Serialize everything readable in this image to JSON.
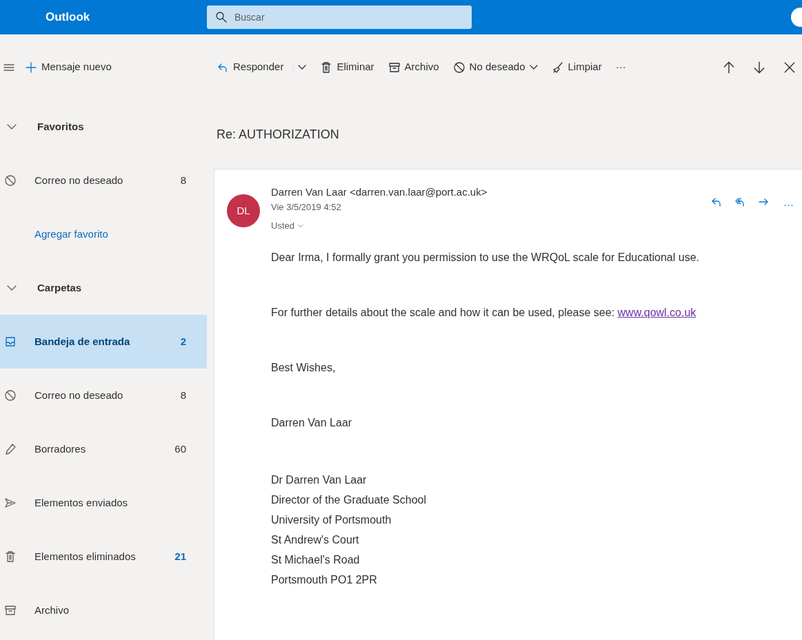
{
  "header": {
    "app_name": "Outlook",
    "search": {
      "placeholder": "Buscar"
    }
  },
  "toolbar": {
    "new_message": "Mensaje nuevo",
    "actions": [
      {
        "kind": "reply",
        "label": "Responder"
      },
      {
        "kind": "split"
      },
      {
        "kind": "delete",
        "label": "Eliminar"
      },
      {
        "kind": "archive",
        "label": "Archivo"
      },
      {
        "kind": "junk",
        "label": "No deseado"
      },
      {
        "kind": "sweep",
        "label": "Limpiar"
      },
      {
        "kind": "more",
        "label": "···"
      }
    ]
  },
  "sidebar": {
    "sections": [
      {
        "title": "Favoritos",
        "expanded": true,
        "items": [
          {
            "kind": "junk",
            "label": "Correo no deseado",
            "count": "8",
            "unread": false,
            "selected": false
          },
          {
            "kind": "add",
            "label": "Agregar favorito",
            "link": true,
            "selected": false
          }
        ]
      },
      {
        "title": "Carpetas",
        "expanded": true,
        "items": [
          {
            "kind": "inbox",
            "label": "Bandeja de entrada",
            "count": "2",
            "unread": true,
            "selected": true
          },
          {
            "kind": "junk",
            "label": "Correo no deseado",
            "count": "8",
            "unread": false,
            "selected": false
          },
          {
            "kind": "draft",
            "label": "Borradores",
            "count": "60",
            "unread": false,
            "selected": false
          },
          {
            "kind": "sent",
            "label": "Elementos enviados",
            "selected": false
          },
          {
            "kind": "delete",
            "label": "Elementos eliminados",
            "count": "21",
            "unread": true,
            "selected": false
          },
          {
            "kind": "archive",
            "label": "Archivo",
            "selected": false
          }
        ]
      }
    ]
  },
  "message": {
    "subject": "Re: AUTHORIZATION",
    "avatar_initials": "DL",
    "sender": "Darren Van Laar <darren.van.laar@port.ac.uk>",
    "date": "Vie 3/5/2019 4:52",
    "to": "Usted",
    "body": [
      {
        "kind": "para",
        "text": "Dear Irma, I formally grant you permission to use the WRQoL scale for Educational use."
      },
      {
        "kind": "para",
        "text": "For further details about the scale and how it can be used, please see: ",
        "link": "www.qowl.co.uk"
      },
      {
        "kind": "para",
        "text": "Best Wishes,"
      },
      {
        "kind": "para",
        "text": "Darren Van Laar"
      },
      {
        "kind": "lines",
        "lines": [
          "Dr Darren Van Laar",
          "Director of the Graduate School",
          "University of Portsmouth",
          "St Andrew's Court",
          "St Michael's Road",
          "Portsmouth PO1 2PR"
        ]
      }
    ]
  }
}
